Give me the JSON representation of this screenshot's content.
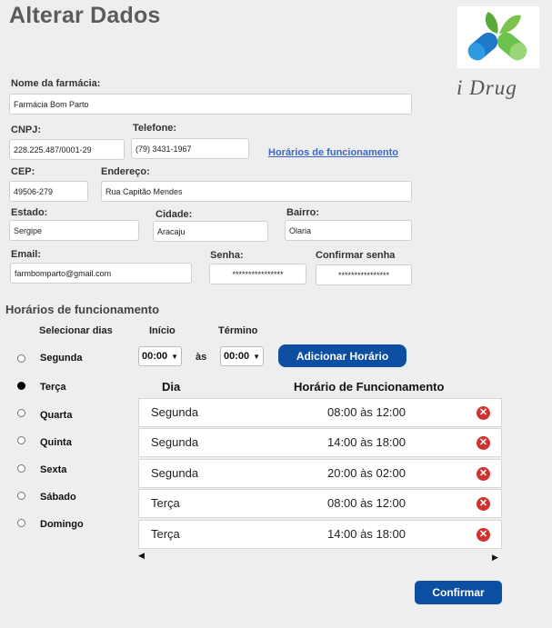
{
  "page": {
    "title": "Alterar Dados",
    "brand": "i Drug"
  },
  "form": {
    "nome_label": "Nome da farmácia:",
    "nome_value": "Farmácia Bom Parto",
    "cnpj_label": "CNPJ:",
    "cnpj_value": "228.225.487/0001-29",
    "telefone_label": "Telefone:",
    "telefone_value": "(79) 3431-1967",
    "horarios_link": "Horários de funcionamento",
    "cep_label": "CEP:",
    "cep_value": "49506-279",
    "endereco_label": "Endereço:",
    "endereco_value": "Rua Capitão Mendes",
    "estado_label": "Estado:",
    "estado_value": "Sergipe",
    "cidade_label": "Cidade:",
    "cidade_value": "Aracaju",
    "bairro_label": "Bairro:",
    "bairro_value": "Olaria",
    "email_label": "Email:",
    "email_value": "farmbomparto@gmail.com",
    "senha_label": "Senha:",
    "senha_value": "****************",
    "confirmar_senha_label": "Confirmar senha",
    "confirmar_senha_value": "****************"
  },
  "schedule": {
    "section_title": "Horários de funcionamento",
    "select_days_label": "Selecionar dias",
    "inicio_label": "Início",
    "termino_label": "Término",
    "inicio_value": "00:00",
    "termino_value": "00:00",
    "as_label": "às",
    "add_button": "Adicionar Horário",
    "days": [
      "Segunda",
      "Terça",
      "Quarta",
      "Quinta",
      "Sexta",
      "Sábado",
      "Domingo"
    ],
    "selected_day": "Terça",
    "table_headers": {
      "dia": "Dia",
      "horario": "Horário de Funcionamento"
    },
    "rows": [
      {
        "dia": "Segunda",
        "horario": "08:00 às 12:00"
      },
      {
        "dia": "Segunda",
        "horario": "14:00 às 18:00"
      },
      {
        "dia": "Segunda",
        "horario": "20:00 às 02:00"
      },
      {
        "dia": "Terça",
        "horario": "08:00 às 12:00"
      },
      {
        "dia": "Terça",
        "horario": "14:00 às 18:00"
      }
    ],
    "scroll_left": "◀",
    "scroll_right": "▶",
    "remove_icon": "✕"
  },
  "confirm_button": "Confirmar",
  "colors": {
    "accent": "#0b4ea2",
    "link": "#3a67c4",
    "remove": "#d0322d",
    "background": "#eeeeee"
  }
}
